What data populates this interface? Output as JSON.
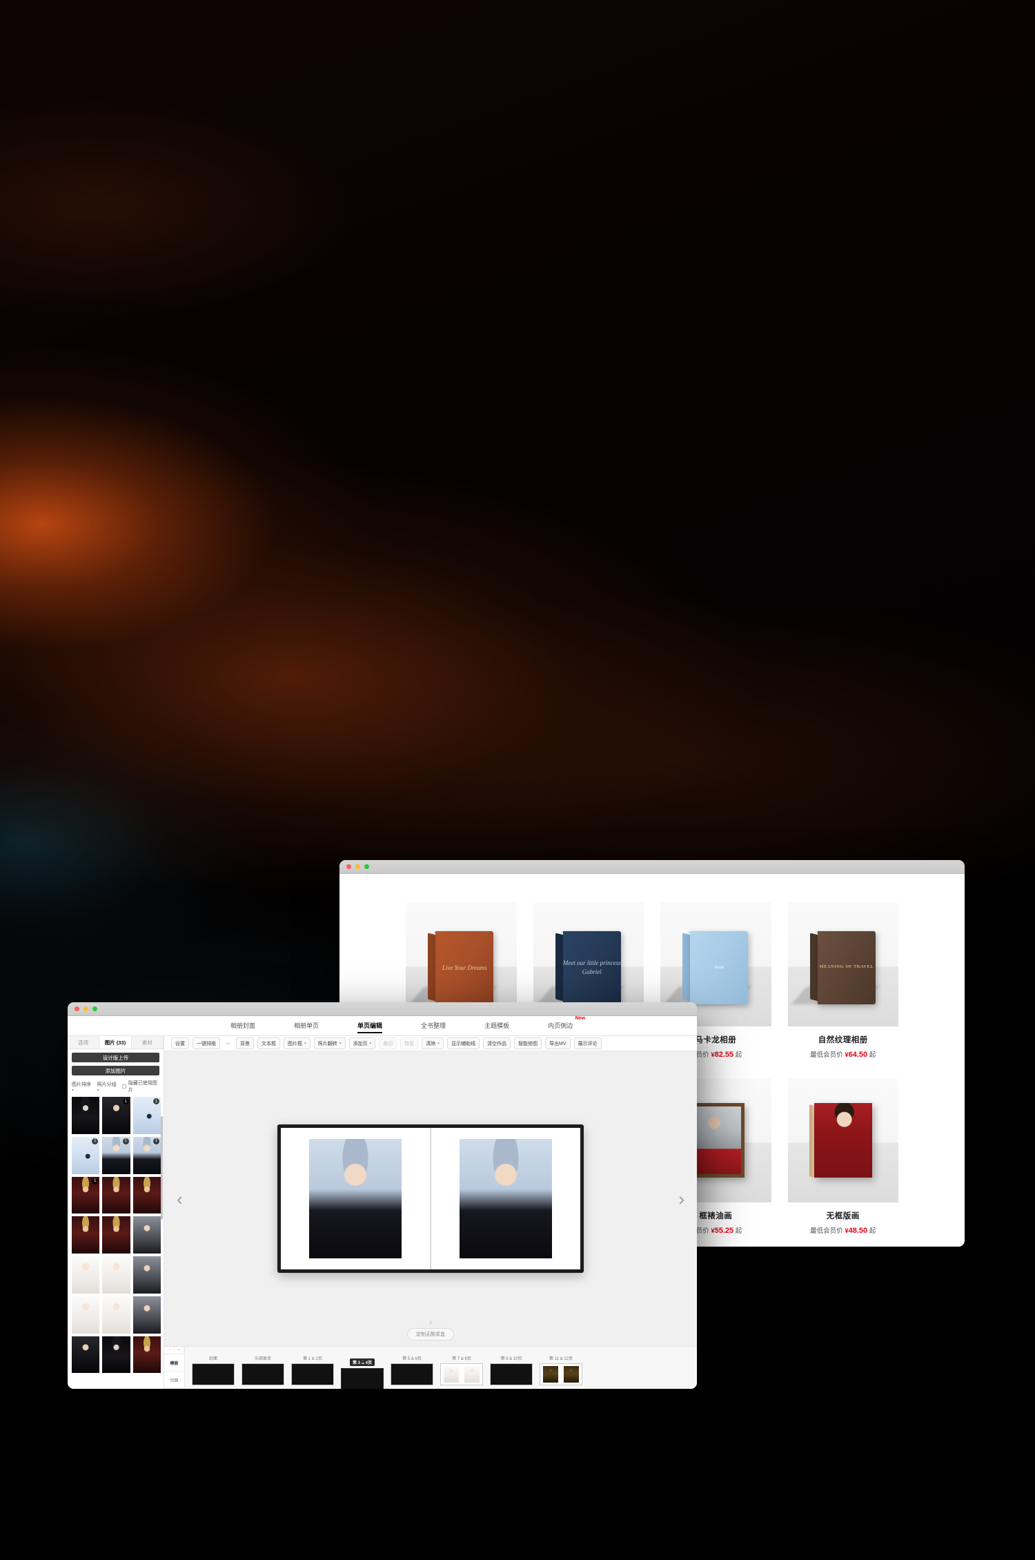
{
  "desktop": {
    "wallpaper_description": "dark gradient wallpaper with amber and teal glow"
  },
  "shop_window": {
    "window_controls": {
      "close": "close-button",
      "minimize": "minimize-button",
      "maximize": "maximize-button"
    },
    "products": [
      {
        "name": "",
        "price_prefix": "",
        "currency": "",
        "price": "",
        "suffix": "",
        "image": "brown-leather-album"
      },
      {
        "name": "",
        "price_prefix": "",
        "currency": "",
        "price": "",
        "suffix": "",
        "image": "navy-velvet-album"
      },
      {
        "name": "马卡龙相册",
        "price_prefix": "会员价",
        "currency": "¥",
        "price": "82.55",
        "suffix": "起",
        "image": "light-blue-album"
      },
      {
        "name": "自然纹理相册",
        "price_prefix": "最低会员价",
        "currency": "¥",
        "price": "64.50",
        "suffix": "起",
        "image": "brown-wood-album"
      },
      {
        "name": "",
        "price_prefix": "",
        "currency": "",
        "price": "",
        "suffix": "",
        "image": "hidden-product-a"
      },
      {
        "name": "",
        "price_prefix": "",
        "currency": "",
        "price": "",
        "suffix": "",
        "image": "hidden-product-b"
      },
      {
        "name": "框裱油画",
        "price_prefix": "会员价",
        "currency": "¥",
        "price": "55.25",
        "suffix": "起",
        "image": "framed-oil-painting"
      },
      {
        "name": "无框版画",
        "price_prefix": "最低会员价",
        "currency": "¥",
        "price": "48.50",
        "suffix": "起",
        "image": "frameless-print"
      }
    ],
    "book_cover_texts": {
      "brown": "Live Your Dreams",
      "navy": "Meet our little princess Gabriel",
      "wood": "MEANING OF TRAVEL"
    }
  },
  "editor_window": {
    "window_controls": {
      "close": "close-button",
      "minimize": "minimize-button",
      "maximize": "maximize-button"
    },
    "nav_tabs": [
      {
        "label": "相册封面",
        "active": false
      },
      {
        "label": "相册单页",
        "active": false
      },
      {
        "label": "单页编辑",
        "active": true
      },
      {
        "label": "全书整理",
        "active": false
      },
      {
        "label": "主题模板",
        "active": false
      },
      {
        "label": "内页侧边",
        "active": false,
        "badge": "New"
      }
    ],
    "photo_panel": {
      "tabs": [
        {
          "label": "选项",
          "active": false
        },
        {
          "label": "图片 (33)",
          "active": true
        },
        {
          "label": "素材",
          "active": false
        }
      ],
      "buttons": [
        {
          "label": "设计版上传"
        },
        {
          "label": "添加图片"
        }
      ],
      "filters": [
        {
          "label": "图片排序",
          "chevron": "chevron-down-icon"
        },
        {
          "label": "照片分组",
          "chevron": "chevron-down-icon"
        }
      ],
      "checkbox": {
        "label": "隐藏已使用图片",
        "checked": false
      },
      "thumbnails": [
        {
          "fill": "f-dark-hat",
          "badge": ""
        },
        {
          "fill": "f-portrait-a",
          "badge": "1"
        },
        {
          "fill": "f-blue-dancer",
          "badge": "1"
        },
        {
          "fill": "f-blue-dancer",
          "badge": "1"
        },
        {
          "fill": "f-silver-cap",
          "badge": "1"
        },
        {
          "fill": "f-silver-cap",
          "badge": "1"
        },
        {
          "fill": "f-gold-crown",
          "badge": "1"
        },
        {
          "fill": "f-gold-crown",
          "badge": ""
        },
        {
          "fill": "f-gold-crown",
          "badge": ""
        },
        {
          "fill": "f-gold-crown",
          "badge": ""
        },
        {
          "fill": "f-gold-crown",
          "badge": ""
        },
        {
          "fill": "f-portrait-b",
          "badge": ""
        },
        {
          "fill": "f-white-dress",
          "badge": ""
        },
        {
          "fill": "f-white-dress",
          "badge": ""
        },
        {
          "fill": "f-portrait-b",
          "badge": ""
        },
        {
          "fill": "f-white-dress",
          "badge": ""
        },
        {
          "fill": "f-white-dress",
          "badge": ""
        },
        {
          "fill": "f-portrait-b",
          "badge": ""
        },
        {
          "fill": "f-portrait-a",
          "badge": ""
        },
        {
          "fill": "f-dark-hat",
          "badge": ""
        },
        {
          "fill": "f-gold-crown",
          "badge": ""
        }
      ]
    },
    "toolbar": [
      {
        "label": "设置",
        "type": "button",
        "disabled": false
      },
      {
        "label": "一键排版",
        "type": "button",
        "disabled": false
      },
      {
        "label": "⋯",
        "type": "plain",
        "disabled": false
      },
      {
        "label": "背景",
        "type": "button",
        "disabled": false
      },
      {
        "label": "文本框",
        "type": "button",
        "disabled": false
      },
      {
        "label": "图片框",
        "type": "dropdown",
        "disabled": false
      },
      {
        "label": "照片翻转",
        "type": "dropdown",
        "disabled": false
      },
      {
        "label": "添加页",
        "type": "dropdown",
        "disabled": false
      },
      {
        "label": "裁切",
        "type": "button",
        "disabled": true
      },
      {
        "label": "恢复",
        "type": "button",
        "disabled": true
      },
      {
        "label": "清除",
        "type": "dropdown",
        "disabled": false
      },
      {
        "label": "显示辅助线",
        "type": "button",
        "disabled": false
      },
      {
        "label": "清空作品",
        "type": "button",
        "disabled": false
      },
      {
        "label": "智能修图",
        "type": "button",
        "disabled": false
      },
      {
        "label": "导出MV",
        "type": "button",
        "disabled": false
      },
      {
        "label": "展示评论",
        "type": "button",
        "disabled": false
      }
    ],
    "canvas": {
      "prev_arrow": "chevron-left-icon",
      "next_arrow": "chevron-right-icon",
      "page_number": "3",
      "custom_button": "定制无酸浆盒",
      "left_photo": "silver-cap-portrait-front",
      "right_photo": "silver-cap-portrait-veil"
    },
    "page_strip": {
      "side_controls": [
        {
          "label": "−",
          "name": "zoom-out-button"
        },
        {
          "label": "+",
          "name": "zoom-in-button"
        }
      ],
      "side_options": [
        {
          "label": "模板",
          "active": true
        },
        {
          "label": "页面",
          "active": false
        }
      ],
      "pages": [
        {
          "label": "封面",
          "selected": false,
          "left": "f-black",
          "right": "f-black",
          "padded": false
        },
        {
          "label": "头部扉页",
          "selected": false,
          "left": "f-maroon",
          "right": "f-maroon",
          "padded": false
        },
        {
          "label": "第 1 & 2页",
          "selected": false,
          "left": "f-dark-hat",
          "right": "f-portrait-a",
          "padded": false
        },
        {
          "label": "第 3 & 4页",
          "selected": true,
          "left": "f-silver-cap",
          "right": "f-silver-cap",
          "padded": false
        },
        {
          "label": "第 5 & 6页",
          "selected": false,
          "left": "f-white-dress",
          "right": "f-portrait-b",
          "padded": false
        },
        {
          "label": "第 7 & 8页",
          "selected": false,
          "left": "f-white-dress",
          "right": "f-white-dress",
          "padded": true
        },
        {
          "label": "第 9 & 10页",
          "selected": false,
          "left": "f-gold-crown",
          "right": "f-gold-crown",
          "padded": false
        },
        {
          "label": "第 11 & 12页",
          "selected": false,
          "left": "f-yellow-fig",
          "right": "f-yellow-fig",
          "padded": true
        }
      ]
    }
  }
}
